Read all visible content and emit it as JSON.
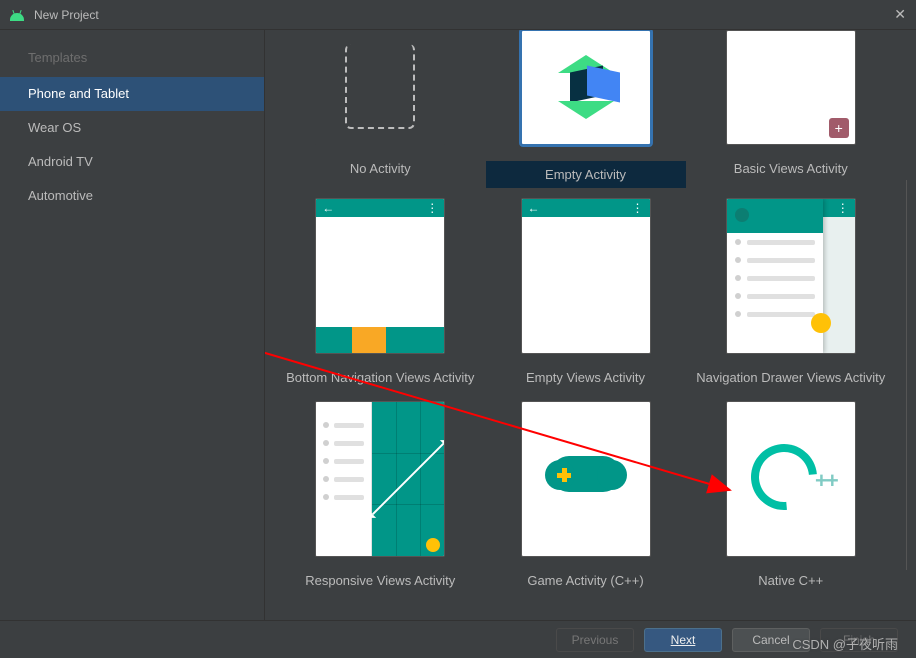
{
  "titlebar": {
    "title": "New Project"
  },
  "sidebar": {
    "heading": "Templates",
    "items": [
      {
        "label": "Phone and Tablet",
        "selected": true
      },
      {
        "label": "Wear OS"
      },
      {
        "label": "Android TV"
      },
      {
        "label": "Automotive"
      }
    ]
  },
  "templates": [
    {
      "id": "no-activity",
      "label": "No Activity"
    },
    {
      "id": "empty-activity",
      "label": "Empty Activity",
      "selected": true
    },
    {
      "id": "basic-views",
      "label": "Basic Views Activity",
      "badge": "+"
    },
    {
      "id": "bottom-nav",
      "label": "Bottom Navigation Views Activity"
    },
    {
      "id": "empty-views",
      "label": "Empty Views Activity"
    },
    {
      "id": "nav-drawer",
      "label": "Navigation Drawer Views Activity"
    },
    {
      "id": "responsive",
      "label": "Responsive Views Activity"
    },
    {
      "id": "game-cpp",
      "label": "Game Activity (C++)"
    },
    {
      "id": "native-cpp",
      "label": "Native C++"
    }
  ],
  "footer": {
    "previous": "Previous",
    "next": "Next",
    "cancel": "Cancel",
    "finish": "Finish"
  },
  "watermark": "CSDN @子夜听雨",
  "cpp_label": "++"
}
